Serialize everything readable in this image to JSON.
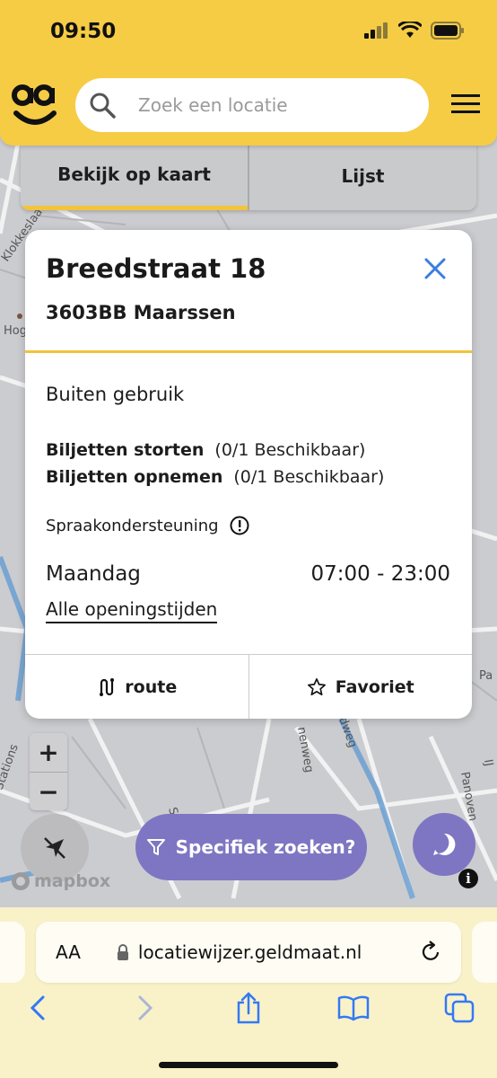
{
  "status_bar": {
    "time": "09:50"
  },
  "header": {
    "search_placeholder": "Zoek een locatie"
  },
  "tabs": [
    {
      "label": "Bekijk op kaart",
      "active": true
    },
    {
      "label": "Lijst",
      "active": false
    }
  ],
  "map_labels": {
    "klokkeslaan": "Klokkeslaan",
    "hog": "Hog",
    "pa": "Pa",
    "nenweg": "nenweg",
    "dweg": "dweg",
    "stations": "Stations",
    "st": "St",
    "panoven": "Panoven",
    "ij": "IJ"
  },
  "card": {
    "title": "Breedstraat 18",
    "city": "3603BB Maarssen",
    "status": "Buiten gebruik",
    "services": [
      {
        "name": "Biljetten storten",
        "availability": "(0/1 Beschikbaar)"
      },
      {
        "name": "Biljetten opnemen",
        "availability": "(0/1 Beschikbaar)"
      }
    ],
    "speech_label": "Spraakondersteuning",
    "day": "Maandag",
    "hours": "07:00 - 23:00",
    "all_hours_link": "Alle openingstijden",
    "route_label": "route",
    "favorite_label": "Favoriet"
  },
  "map_controls": {
    "zoom_in": "+",
    "zoom_out": "−",
    "filter_label": "Specifiek zoeken?",
    "attribution": "mapbox",
    "info": "i"
  },
  "browser": {
    "aa_label": "AA",
    "url": "locatiewijzer.geldmaat.nl"
  },
  "colors": {
    "brand_yellow": "#f6cc45",
    "accent_yellow": "#f3c33b",
    "action_purple": "#7e76c2",
    "close_blue": "#3b7de0"
  }
}
